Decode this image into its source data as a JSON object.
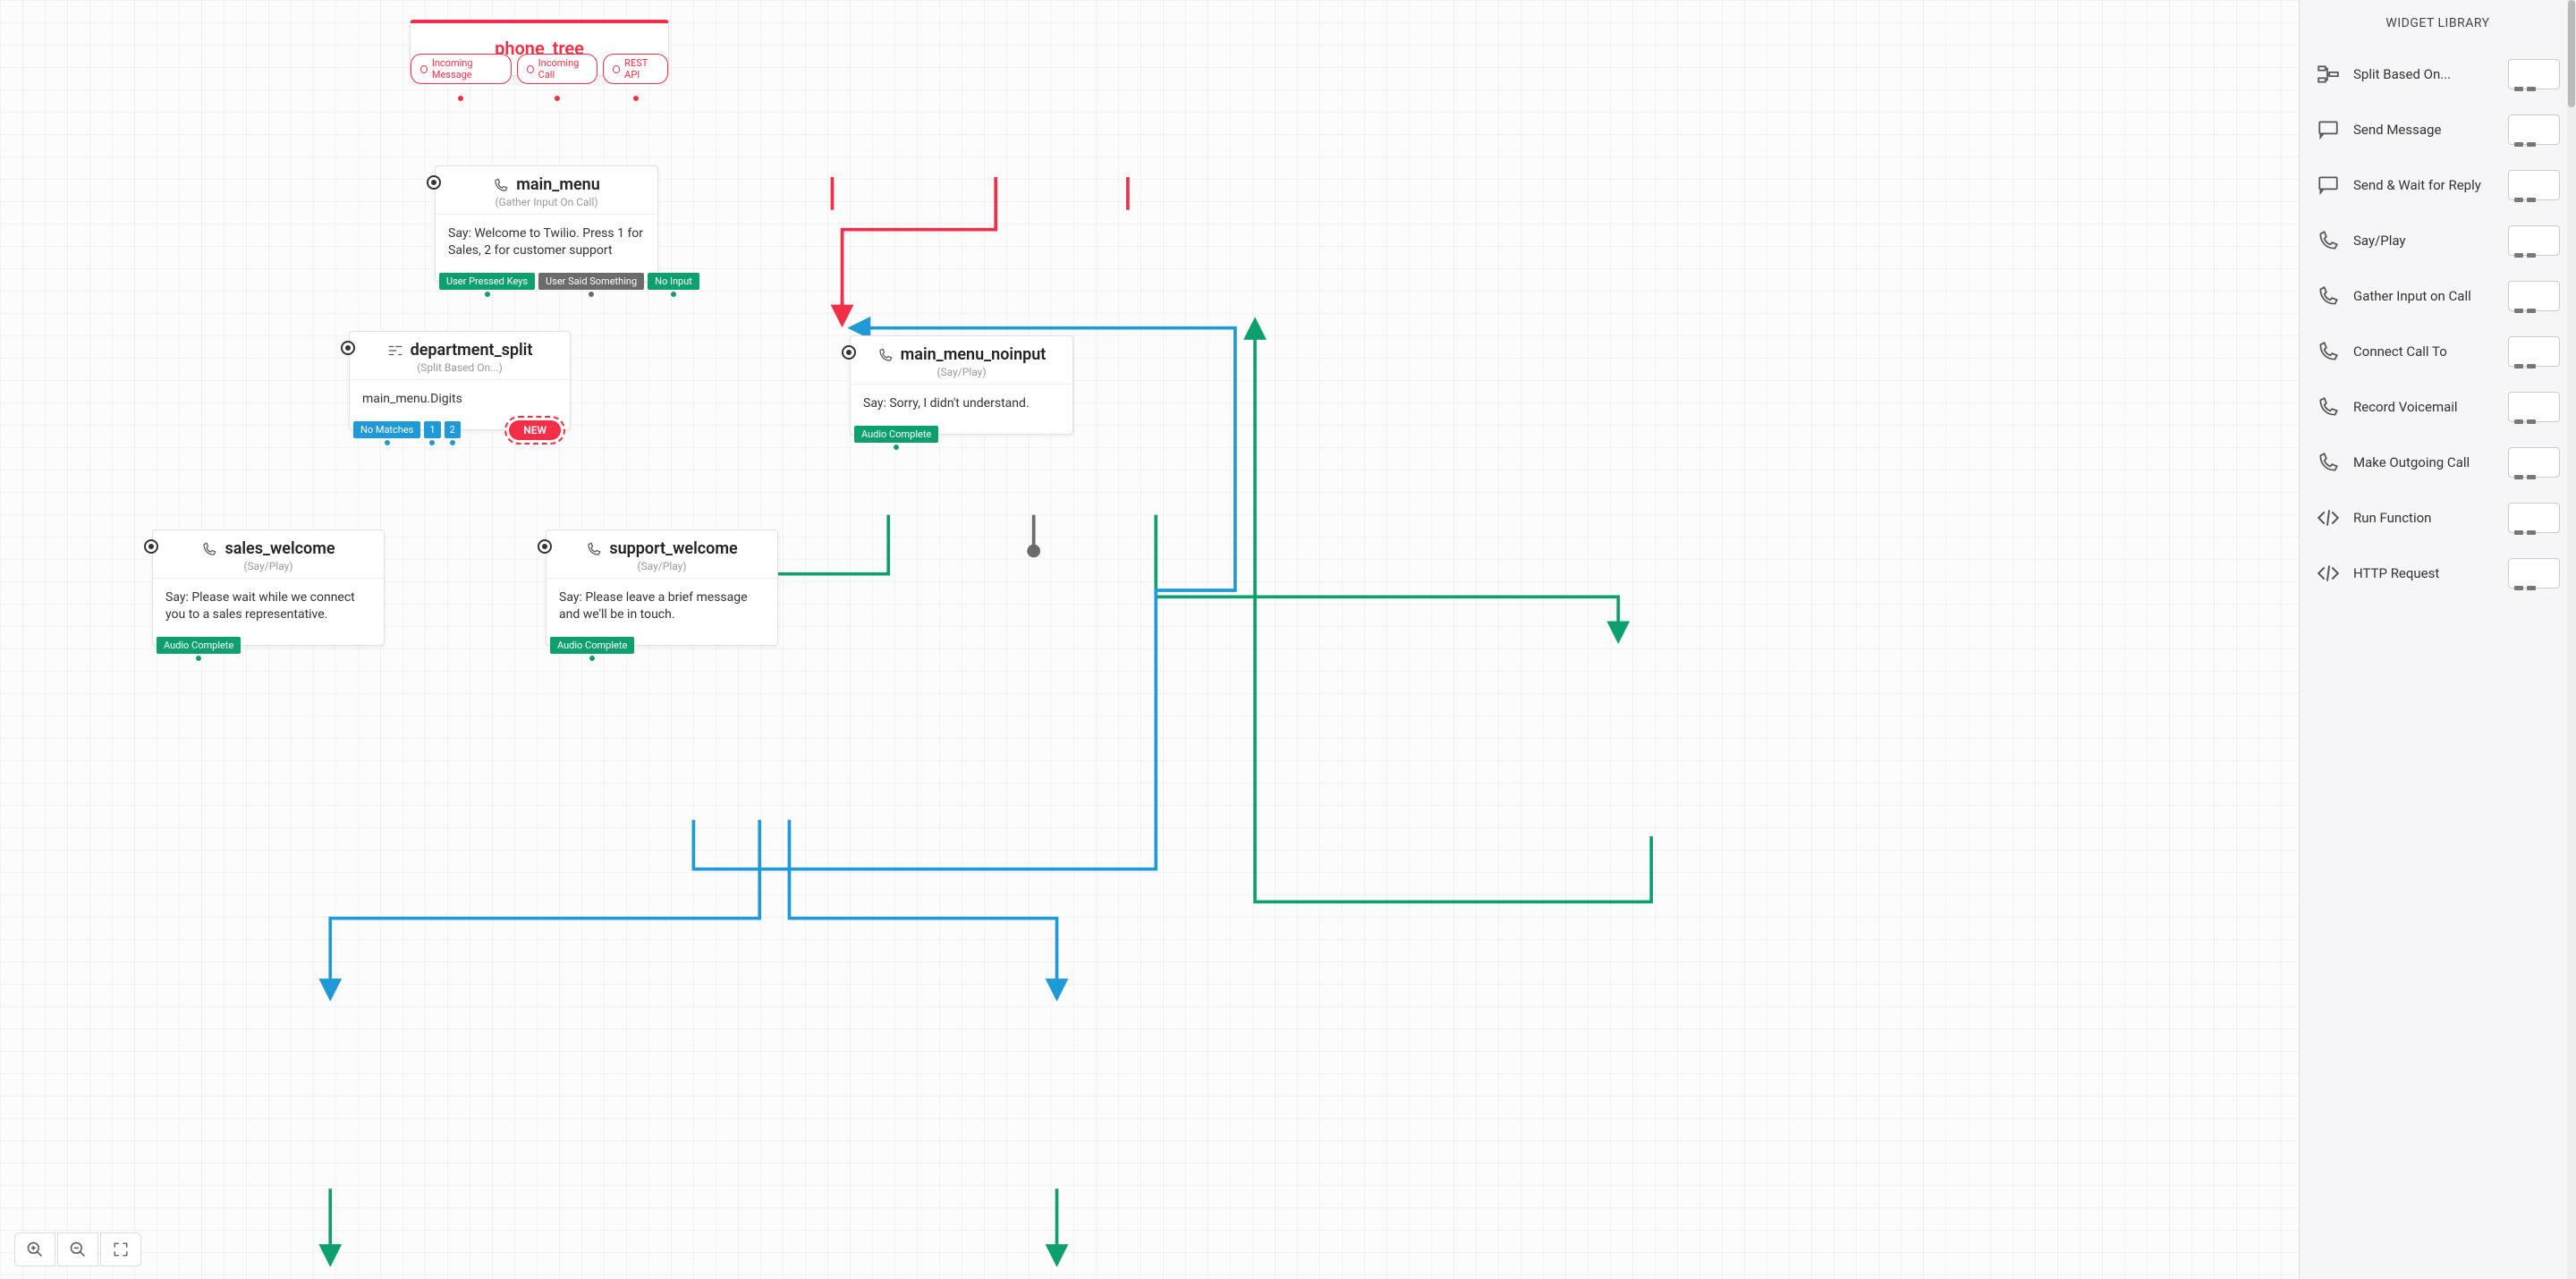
{
  "trigger": {
    "title": "phone_tree",
    "outputs": [
      "Incoming Message",
      "Incoming Call",
      "REST API"
    ]
  },
  "nodes": {
    "main_menu": {
      "title": "main_menu",
      "subtitle": "(Gather Input On Call)",
      "body": "Say: Welcome to Twilio. Press 1 for Sales, 2 for customer support",
      "outputs": [
        "User Pressed Keys",
        "User Said Something",
        "No Input"
      ]
    },
    "department_split": {
      "title": "department_split",
      "subtitle": "(Split Based On...)",
      "body": "main_menu.Digits",
      "outputs": [
        "No Matches",
        "1",
        "2"
      ],
      "new_label": "NEW"
    },
    "main_menu_noinput": {
      "title": "main_menu_noinput",
      "subtitle": "(Say/Play)",
      "body": "Say: Sorry, I didn't understand.",
      "outputs": [
        "Audio Complete"
      ]
    },
    "sales_welcome": {
      "title": "sales_welcome",
      "subtitle": "(Say/Play)",
      "body": "Say: Please wait while we connect you to a sales representative.",
      "outputs": [
        "Audio Complete"
      ]
    },
    "support_welcome": {
      "title": "support_welcome",
      "subtitle": "(Say/Play)",
      "body": "Say: Please leave a brief message and we'll be in touch.",
      "outputs": [
        "Audio Complete"
      ]
    }
  },
  "sidebar": {
    "title": "WIDGET LIBRARY",
    "items": [
      {
        "icon": "split",
        "label": "Split Based On..."
      },
      {
        "icon": "msg",
        "label": "Send Message"
      },
      {
        "icon": "msg",
        "label": "Send & Wait for Reply"
      },
      {
        "icon": "phone",
        "label": "Say/Play"
      },
      {
        "icon": "phone",
        "label": "Gather Input on Call"
      },
      {
        "icon": "phone",
        "label": "Connect Call To"
      },
      {
        "icon": "phone",
        "label": "Record Voicemail"
      },
      {
        "icon": "phone",
        "label": "Make Outgoing Call"
      },
      {
        "icon": "code",
        "label": "Run Function"
      },
      {
        "icon": "code",
        "label": "HTTP Request"
      }
    ]
  },
  "zoom": {
    "in": "+",
    "out": "−",
    "fit": "⛶"
  }
}
